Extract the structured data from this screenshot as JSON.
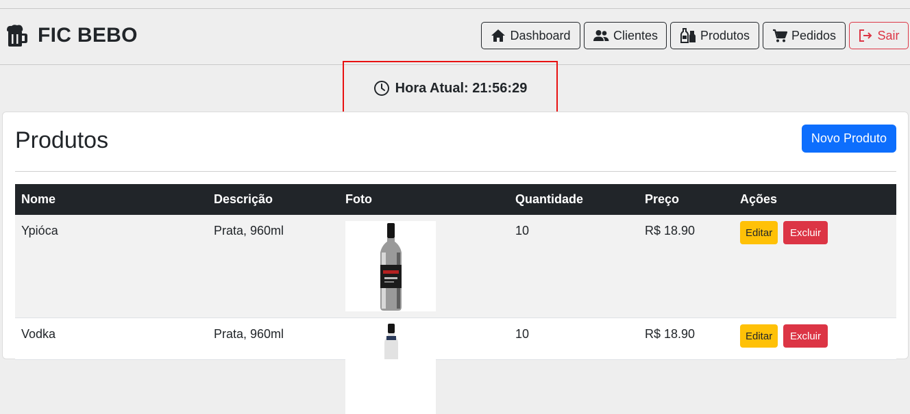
{
  "brand": {
    "name": "FIC BEBO",
    "icon": "beer-mug-icon"
  },
  "nav": {
    "dashboard": "Dashboard",
    "clientes": "Clientes",
    "produtos": "Produtos",
    "pedidos": "Pedidos",
    "sair": "Sair"
  },
  "clock": {
    "text": "Hora Atual: 21:56:29",
    "icon": "clock-icon"
  },
  "page": {
    "title": "Produtos",
    "new_button": "Novo Produto"
  },
  "table": {
    "headers": [
      "Nome",
      "Descrição",
      "Foto",
      "Quantidade",
      "Preço",
      "Ações"
    ],
    "rows": [
      {
        "nome": "Ypióca",
        "descricao": "Prata, 960ml",
        "quantidade": "10",
        "preco": "R$ 18.90",
        "editar": "Editar",
        "excluir": "Excluir"
      },
      {
        "nome": "Vodka",
        "descricao": "Prata, 960ml",
        "quantidade": "10",
        "preco": "R$ 18.90",
        "editar": "Editar",
        "excluir": "Excluir"
      }
    ]
  },
  "colors": {
    "primary": "#0d6efd",
    "warning": "#ffc107",
    "danger": "#dc3545",
    "dark": "#212529",
    "highlight": "#e81010"
  }
}
